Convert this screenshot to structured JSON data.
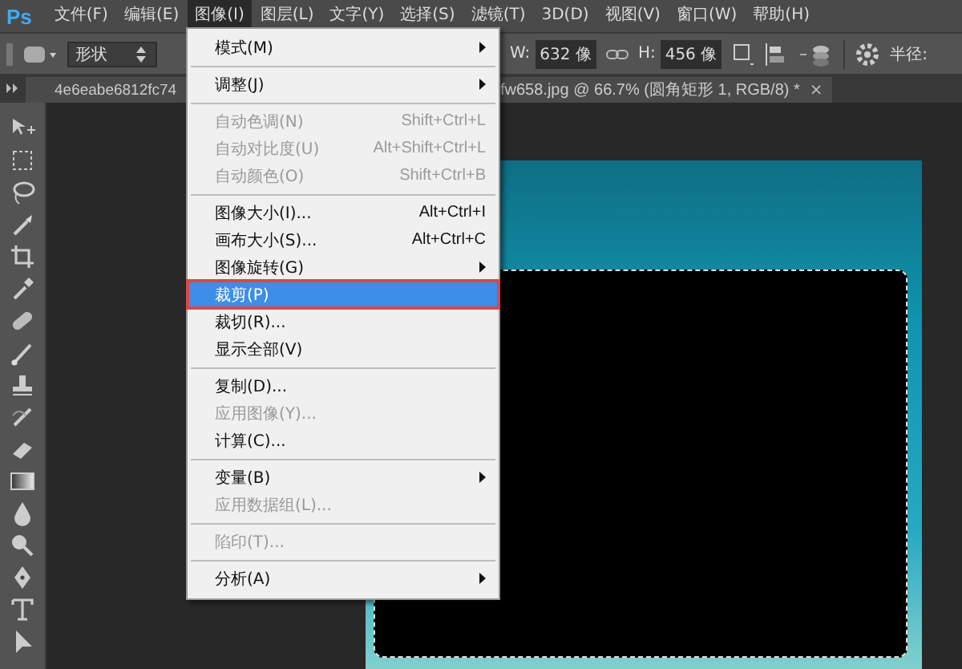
{
  "app_logo": "Ps",
  "menu_bar": [
    {
      "label": "文件(F)",
      "selected": false
    },
    {
      "label": "编辑(E)",
      "selected": false
    },
    {
      "label": "图像(I)",
      "selected": true
    },
    {
      "label": "图层(L)",
      "selected": false
    },
    {
      "label": "文字(Y)",
      "selected": false
    },
    {
      "label": "选择(S)",
      "selected": false
    },
    {
      "label": "滤镜(T)",
      "selected": false
    },
    {
      "label": "3D(D)",
      "selected": false
    },
    {
      "label": "视图(V)",
      "selected": false
    },
    {
      "label": "窗口(W)",
      "selected": false
    },
    {
      "label": "帮助(H)",
      "selected": false
    }
  ],
  "options_bar": {
    "shape_mode": "形状",
    "width_label": "W:",
    "width_value": "632 像",
    "height_label": "H:",
    "height_value": "456 像",
    "radius_label": "半径:"
  },
  "document_tab": {
    "title_parts": [
      "4e6eabe6812fc74",
      "fw658.jpg @ 66.7% (圆角矩形 1, RGB/8) *"
    ],
    "close": "×"
  },
  "image_menu": [
    {
      "kind": "item",
      "label": "模式(M)",
      "disabled": false,
      "submenu": true,
      "selected": false,
      "outlined": false
    },
    {
      "kind": "separator"
    },
    {
      "kind": "item",
      "label": "调整(J)",
      "disabled": false,
      "submenu": true,
      "selected": false,
      "outlined": false
    },
    {
      "kind": "separator"
    },
    {
      "kind": "item",
      "label": "自动色调(N)",
      "shortcut": "Shift+Ctrl+L",
      "disabled": true,
      "submenu": false,
      "selected": false,
      "outlined": false
    },
    {
      "kind": "item",
      "label": "自动对比度(U)",
      "shortcut": "Alt+Shift+Ctrl+L",
      "disabled": true,
      "submenu": false,
      "selected": false,
      "outlined": false
    },
    {
      "kind": "item",
      "label": "自动颜色(O)",
      "shortcut": "Shift+Ctrl+B",
      "disabled": true,
      "submenu": false,
      "selected": false,
      "outlined": false
    },
    {
      "kind": "separator"
    },
    {
      "kind": "item",
      "label": "图像大小(I)...",
      "shortcut": "Alt+Ctrl+I",
      "disabled": false,
      "submenu": false,
      "selected": false,
      "outlined": false
    },
    {
      "kind": "item",
      "label": "画布大小(S)...",
      "shortcut": "Alt+Ctrl+C",
      "disabled": false,
      "submenu": false,
      "selected": false,
      "outlined": false
    },
    {
      "kind": "item",
      "label": "图像旋转(G)",
      "disabled": false,
      "submenu": true,
      "selected": false,
      "outlined": false
    },
    {
      "kind": "item",
      "label": "裁剪(P)",
      "disabled": false,
      "submenu": false,
      "selected": true,
      "outlined": true
    },
    {
      "kind": "item",
      "label": "裁切(R)...",
      "disabled": false,
      "submenu": false,
      "selected": false,
      "outlined": false
    },
    {
      "kind": "item",
      "label": "显示全部(V)",
      "disabled": false,
      "submenu": false,
      "selected": false,
      "outlined": false
    },
    {
      "kind": "separator"
    },
    {
      "kind": "item",
      "label": "复制(D)...",
      "disabled": false,
      "submenu": false,
      "selected": false,
      "outlined": false
    },
    {
      "kind": "item",
      "label": "应用图像(Y)...",
      "disabled": true,
      "submenu": false,
      "selected": false,
      "outlined": false
    },
    {
      "kind": "item",
      "label": "计算(C)...",
      "disabled": false,
      "submenu": false,
      "selected": false,
      "outlined": false
    },
    {
      "kind": "separator"
    },
    {
      "kind": "item",
      "label": "变量(B)",
      "disabled": false,
      "submenu": true,
      "selected": false,
      "outlined": false
    },
    {
      "kind": "item",
      "label": "应用数据组(L)...",
      "disabled": true,
      "submenu": false,
      "selected": false,
      "outlined": false
    },
    {
      "kind": "separator"
    },
    {
      "kind": "item",
      "label": "陷印(T)...",
      "disabled": true,
      "submenu": false,
      "selected": false,
      "outlined": false
    },
    {
      "kind": "separator"
    },
    {
      "kind": "item",
      "label": "分析(A)",
      "disabled": false,
      "submenu": true,
      "selected": false,
      "outlined": false
    }
  ]
}
